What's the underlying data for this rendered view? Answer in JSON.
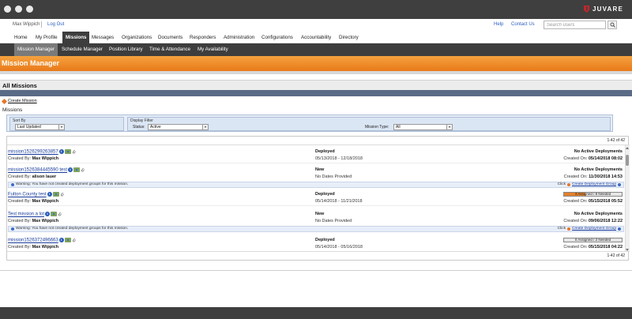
{
  "brand": {
    "name": "JUVARE",
    "color": "#c0272d"
  },
  "util": {
    "user": "Max Wippich",
    "logout": "Log Out",
    "help": "Help",
    "contact": "Contact Us",
    "search_placeholder": "Search users"
  },
  "mainnav": [
    "Home",
    "My Profile",
    "Missions",
    "Messages",
    "Organizations",
    "Documents",
    "Responders",
    "Administration",
    "Configurations",
    "Accountability",
    "Directory"
  ],
  "mainnav_active": "Missions",
  "subnav": [
    "Mission Manager",
    "Schedule Manager",
    "Position Library",
    "Time & Attendance",
    "My Availability"
  ],
  "subnav_active": "Mission Manager",
  "page_title": "Mission Manager",
  "section_title": "All Missions",
  "create_mission": "Create Mission",
  "missions_label": "Missions",
  "filters": {
    "sort_by_label": "Sort By",
    "sort_by_value": "Last Updated",
    "display_filter_label": "Display Filter",
    "status_label": "Status:",
    "status_value": "Active",
    "mission_type_label": "Mission Type:",
    "mission_type_value": "All"
  },
  "pagination": {
    "top": "1-42 of 42",
    "bottom": "1-42 of 42"
  },
  "warning_text": "Warning: You have not created deployment groups for this mission.",
  "warning_click": "Click",
  "warning_link": "Create Deployment Group",
  "created_by_label": "Created By:",
  "created_on_label": "Created On:",
  "missions": [
    {
      "name": "mission1526299263857",
      "created_by": "Max Wippich",
      "status": "Deployed",
      "dates": "05/13/2018 - 12/18/2018",
      "deploy": "No Active Deployments",
      "created_on": "05/14/2018 08:02",
      "bar": null,
      "warning": false
    },
    {
      "name": "mission1526384445590 test",
      "created_by": "alison lauer",
      "status": "New",
      "dates": "No Dates Provided",
      "deploy": "No Active Deployments",
      "created_on": "11/30/2018 14:53",
      "bar": null,
      "warning": true
    },
    {
      "name": "Fulton County test",
      "created_by": "Max Wippich",
      "status": "Deployed",
      "dates": "05/14/2018 - 11/21/2018",
      "deploy": null,
      "created_on": "05/15/2018 05:52",
      "bar": {
        "label": "3 Assigned / 8 Needed",
        "fill": 0.375,
        "color": "#e2822d"
      },
      "warning": false
    },
    {
      "name": "Test mission a lot",
      "created_by": "Max Wippich",
      "status": "New",
      "dates": "No Dates Provided",
      "deploy": "No Active Deployments",
      "created_on": "09/06/2018 12:22",
      "bar": null,
      "warning": true
    },
    {
      "name": "mission1526372496663",
      "created_by": "Max Wippich",
      "status": "Deployed",
      "dates": "05/14/2018 - 05/16/2018",
      "deploy": null,
      "created_on": "05/15/2018 04:22",
      "bar": {
        "label": "0 Assigned / 2 Needed",
        "fill": 0,
        "color": "#e2822d"
      },
      "warning": false
    }
  ],
  "colors": {
    "orange": "#f08a2c",
    "dark": "#3d3d3d",
    "slate": "#5a6b86"
  }
}
